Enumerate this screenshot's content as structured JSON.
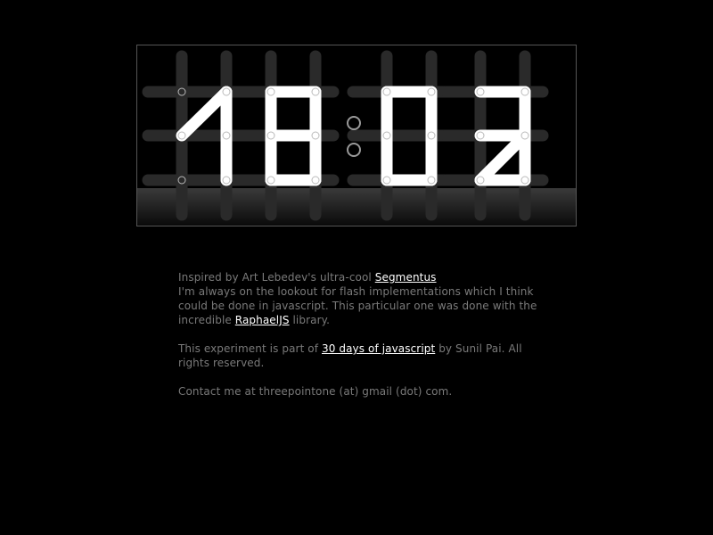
{
  "clock": {
    "digits": [
      "1",
      "8",
      "0",
      "3"
    ],
    "separator": ":"
  },
  "info": {
    "p1_intro": "Inspired by Art Lebedev's ultra-cool ",
    "p1_link": "Segmentus",
    "p1_text": "I'm always on the lookout for flash implementations which I think could be done in javascript. This particular one was done with the incredible ",
    "p1_link2": "RaphaelJS",
    "p1_end": " library.",
    "p2_start": "This experiment is part of ",
    "p2_link": "30 days of javascript",
    "p2_end": " by Sunil Pai. All rights reserved.",
    "p3": "Contact me at threepointone (at) gmail (dot) com."
  },
  "colors": {
    "background": "#000000",
    "segment_on": "#ffffff",
    "segment_off": "#2a2a2a",
    "text": "#7a7a7a",
    "link": "#ffffff"
  }
}
